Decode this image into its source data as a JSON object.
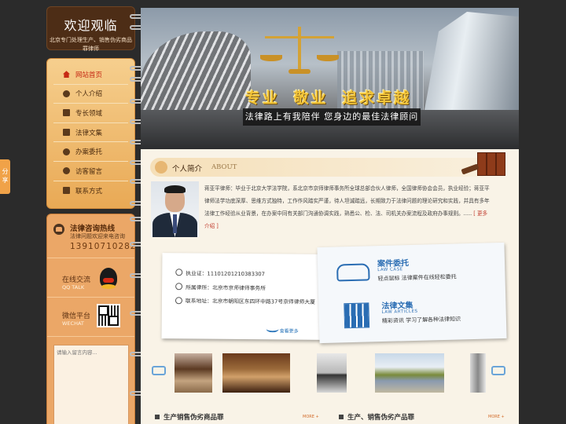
{
  "share": {
    "label": "分享"
  },
  "sidebar": {
    "welcome_title": "欢迎观临",
    "welcome_sub": "北京专门处理生产、销售伪劣商品罪律师",
    "nav": [
      {
        "label": "网站首页",
        "icon": "home-icon",
        "active": true
      },
      {
        "label": "个人介绍",
        "icon": "person-icon"
      },
      {
        "label": "专长领域",
        "icon": "star-icon"
      },
      {
        "label": "法律文集",
        "icon": "book-icon"
      },
      {
        "label": "办案委托",
        "icon": "briefcase-icon"
      },
      {
        "label": "访客留言",
        "icon": "chat-icon"
      },
      {
        "label": "联系方式",
        "icon": "phone-icon"
      }
    ],
    "hotline": {
      "title": "法律咨询热线",
      "sub": "法律问题欢迎来电咨询",
      "number": "13910710282"
    },
    "qq": {
      "title": "在线交流",
      "sub": "QQ TALK"
    },
    "wechat": {
      "title": "微信平台",
      "sub": "WECHAT"
    },
    "message_placeholder": "请输入留言内容..."
  },
  "banner": {
    "slogan_main": "专业 敬业 追求卓越",
    "slogan_sub": "法律路上有我陪伴 您身边的最佳法律顾问"
  },
  "about": {
    "title": "个人简介",
    "title_en": "ABOUT",
    "text": "蒋亚平律师：毕业于北京大学法学院，系北京市京师律师事务所全球总部合伙人律师，全国律师协会会员，执业经验；蒋亚平律师法学功底深厚、思维方式独特，工作作风踏实严谨，待人坦诚踏远，长期致力于法律问题的理论研究和实践，并具有多年法律工作经验从业背景，在办案中同有关部门沟通协调实践，熟悉公、检、法、司机关办案流程及政府办事规则。.....",
    "more": "[ 更多介绍 ]"
  },
  "info": {
    "license": "执业证：11101201210383307",
    "firm": "所属律所：北京市京师律师事务所",
    "address": "联系地址：北京市朝阳区东四环中路37号京师律师大厦",
    "view_more": "查看更多"
  },
  "cards": {
    "case": {
      "title": "案件委托",
      "en": "LAW CASE",
      "desc": "轻点鼠标  法律案件在线轻松委托"
    },
    "articles": {
      "title": "法律文集",
      "en": "LAW ARTICLES",
      "desc": "精彩资讯  学习了解各种法律知识"
    }
  },
  "bottom": {
    "left_title": "生产销售伪劣商品罪",
    "right_title": "生产、销售伪劣产品罪",
    "more": "MORE +"
  }
}
